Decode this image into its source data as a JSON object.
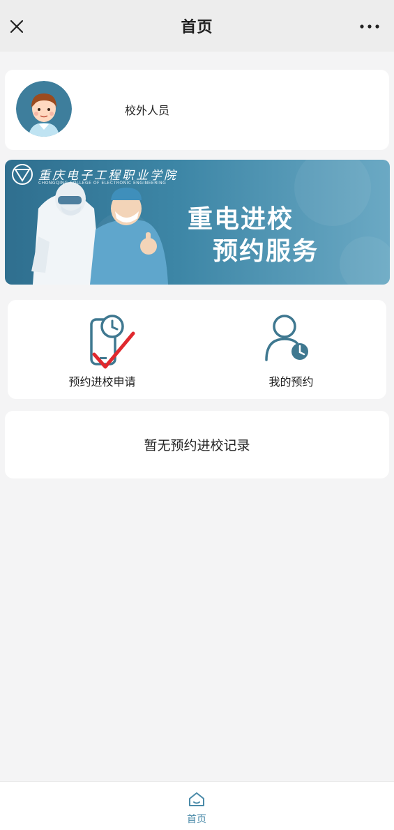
{
  "titlebar": {
    "title": "首页"
  },
  "profile": {
    "name": "校外人员"
  },
  "banner": {
    "school_name": "重庆电子工程职业学院",
    "school_name_en": "CHONGQING COLLEGE OF ELECTRONIC ENGINEERING",
    "headline_line1": "重电进校",
    "headline_line2": "预约服务"
  },
  "actions": [
    {
      "label": "预约进校申请"
    },
    {
      "label": "我的预约"
    }
  ],
  "records": {
    "empty_text": "暂无预约进校记录"
  },
  "tabbar": {
    "home_label": "首页"
  },
  "colors": {
    "accent": "#4a8aa8",
    "check": "#e0292e",
    "icon": "#3f7890"
  }
}
